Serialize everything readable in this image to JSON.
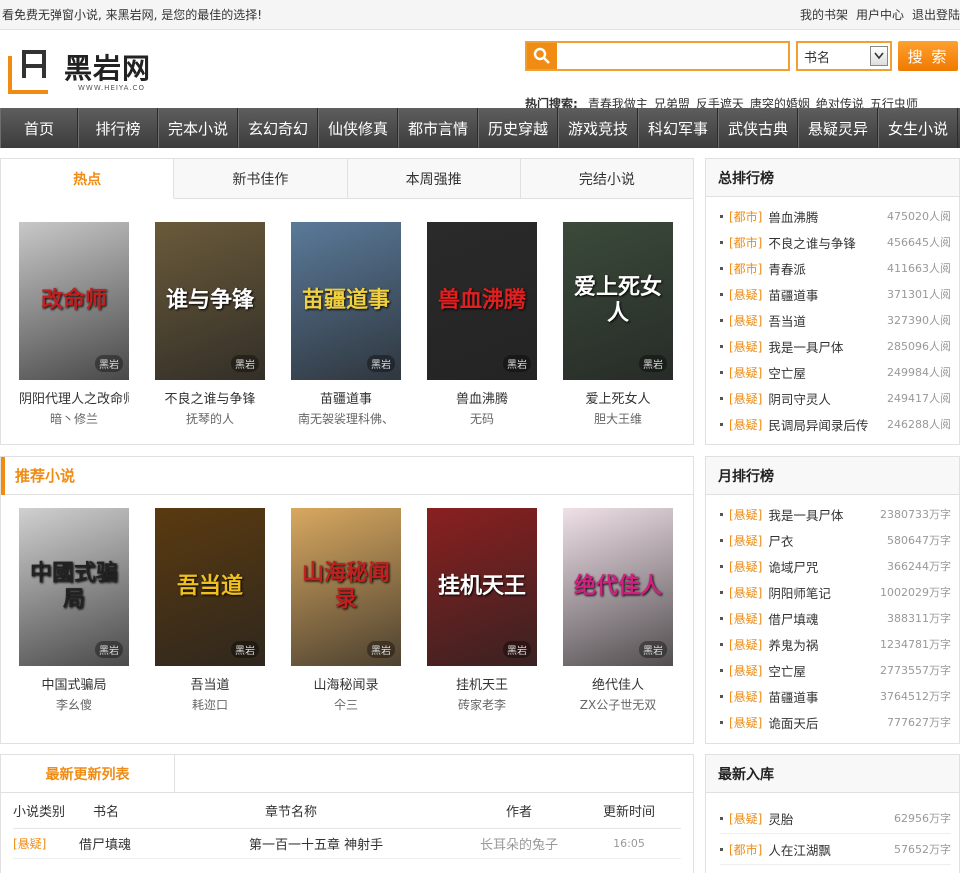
{
  "topbar": {
    "slogan": "看免费无弹窗小说, 来黑岩网, 是您的最佳的选择!",
    "links": [
      "我的书架",
      "用户中心",
      "退出登陆"
    ]
  },
  "logo": {
    "name": "黑岩网",
    "domain": "WWW.HEIYA.CO"
  },
  "search": {
    "placeholder": "",
    "type_selected": "书名",
    "button": "搜 索"
  },
  "hot": {
    "label": "热门搜索:",
    "items": [
      "青春我做主",
      "兄弟盟",
      "反手遮天",
      "唐突的婚姻",
      "绝对传说",
      "五行虫师"
    ]
  },
  "nav": [
    "首页",
    "排行榜",
    "完本小说",
    "玄幻奇幻",
    "仙侠修真",
    "都市言情",
    "历史穿越",
    "游戏竞技",
    "科幻军事",
    "武侠古典",
    "悬疑灵异",
    "女生小说"
  ],
  "tabs": {
    "items": [
      "热点",
      "新书佳作",
      "本周强推",
      "完结小说"
    ],
    "active": 0
  },
  "hot_books": [
    {
      "title": "阴阳代理人之改命师",
      "author": "暗丶修兰",
      "cover_text": "改命师",
      "bg": "#c8c8c8",
      "fg": "#c02020"
    },
    {
      "title": "不良之谁与争锋",
      "author": "抚琴的人",
      "cover_text": "谁与争锋",
      "bg": "#6a5a3a",
      "fg": "#ffffff"
    },
    {
      "title": "苗疆道事",
      "author": "南无袈裟理科佛、",
      "cover_text": "苗疆道事",
      "bg": "#5a7a9a",
      "fg": "#f0d040"
    },
    {
      "title": "兽血沸腾",
      "author": "无码",
      "cover_text": "兽血沸腾",
      "bg": "#2a2a2a",
      "fg": "#e02020"
    },
    {
      "title": "爱上死女人",
      "author": "胆大王维",
      "cover_text": "爱上死女人",
      "bg": "#3a4a3a",
      "fg": "#ffffff"
    }
  ],
  "recommend": {
    "title": "推荐小说",
    "books": [
      {
        "title": "中国式骗局",
        "author": "李幺傻",
        "cover_text": "中國式骗局",
        "bg": "#d0d0d0",
        "fg": "#222222"
      },
      {
        "title": "吾当道",
        "author": "耗迩口",
        "cover_text": "吾当道",
        "bg": "#5a3a10",
        "fg": "#f0c020"
      },
      {
        "title": "山海秘闻录",
        "author": "仐三",
        "cover_text": "山海秘闻录",
        "bg": "#d8a860",
        "fg": "#c02020"
      },
      {
        "title": "挂机天王",
        "author": "砖家老李",
        "cover_text": "挂机天王",
        "bg": "#8a2020",
        "fg": "#ffffff"
      },
      {
        "title": "绝代佳人",
        "author": "ZX公子世无双",
        "cover_text": "绝代佳人",
        "bg": "#f0e0e8",
        "fg": "#d02080"
      }
    ]
  },
  "watermark": "黑岩",
  "total_rank": {
    "title": "总排行榜",
    "items": [
      {
        "cat": "[都市]",
        "name": "兽血沸腾",
        "count": "475020人阅"
      },
      {
        "cat": "[都市]",
        "name": "不良之谁与争锋",
        "count": "456645人阅"
      },
      {
        "cat": "[都市]",
        "name": "青春派",
        "count": "411663人阅"
      },
      {
        "cat": "[悬疑]",
        "name": "苗疆道事",
        "count": "371301人阅"
      },
      {
        "cat": "[悬疑]",
        "name": "吾当道",
        "count": "327390人阅"
      },
      {
        "cat": "[悬疑]",
        "name": "我是一具尸体",
        "count": "285096人阅"
      },
      {
        "cat": "[悬疑]",
        "name": "空亡屋",
        "count": "249984人阅"
      },
      {
        "cat": "[悬疑]",
        "name": "阴司守灵人",
        "count": "249417人阅"
      },
      {
        "cat": "[悬疑]",
        "name": "民调局异闻录后传",
        "count": "246288人阅"
      }
    ]
  },
  "month_rank": {
    "title": "月排行榜",
    "items": [
      {
        "cat": "[悬疑]",
        "name": "我是一具尸体",
        "count": "2380733万字"
      },
      {
        "cat": "[悬疑]",
        "name": "尸衣",
        "count": "580647万字"
      },
      {
        "cat": "[悬疑]",
        "name": "诡域尸咒",
        "count": "366244万字"
      },
      {
        "cat": "[悬疑]",
        "name": "阴阳师笔记",
        "count": "1002029万字"
      },
      {
        "cat": "[悬疑]",
        "name": "借尸填魂",
        "count": "388311万字"
      },
      {
        "cat": "[悬疑]",
        "name": "养鬼为祸",
        "count": "1234781万字"
      },
      {
        "cat": "[悬疑]",
        "name": "空亡屋",
        "count": "2773557万字"
      },
      {
        "cat": "[悬疑]",
        "name": "苗疆道事",
        "count": "3764512万字"
      },
      {
        "cat": "[悬疑]",
        "name": "诡面天后",
        "count": "777627万字"
      }
    ]
  },
  "new_in": {
    "title": "最新入库",
    "items": [
      {
        "cat": "[悬疑]",
        "name": "灵胎",
        "count": "62956万字"
      },
      {
        "cat": "[都市]",
        "name": "人在江湖飘",
        "count": "57652万字"
      }
    ]
  },
  "latest": {
    "title": "最新更新列表",
    "headers": [
      "小说类别",
      "书名",
      "章节名称",
      "作者",
      "更新时间"
    ],
    "rows": [
      {
        "cat": "[悬疑]",
        "book": "借尸填魂",
        "chapter": "第一百一十五章 神射手",
        "author": "长耳朵的兔子",
        "time": "16:05"
      }
    ]
  },
  "colors": {
    "accent": "#f08c14",
    "nav": "#4a4a4a"
  }
}
